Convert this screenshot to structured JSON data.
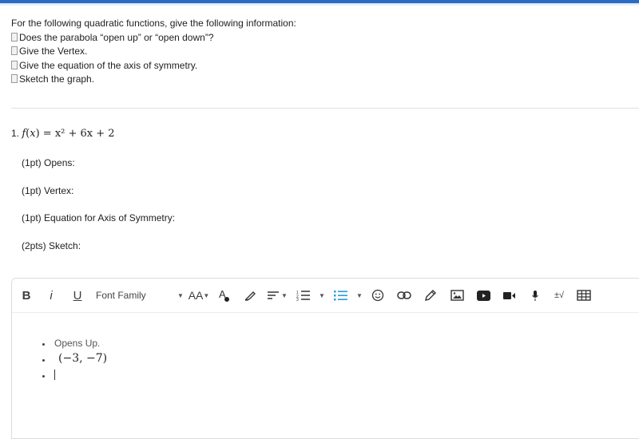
{
  "instructions": {
    "heading": "For the following quadratic functions, give the following information:",
    "items": [
      "Does the parabola “open up” or “open down”?",
      "Give the Vertex.",
      "Give the equation of the axis of symmetry.",
      "Sketch the graph."
    ]
  },
  "question": {
    "number": "1.",
    "function_name": "f",
    "variable": "x",
    "equation_rhs": "x² + 6x + 2",
    "parts": [
      {
        "label": "(1pt) Opens:"
      },
      {
        "label": "(1pt) Vertex:"
      },
      {
        "label": "(1pt)  Equation for Axis of Symmetry:"
      },
      {
        "label": "(2pts)  Sketch:"
      }
    ]
  },
  "toolbar": {
    "bold": "B",
    "italic": "i",
    "underline": "U",
    "font_family": "Font Family",
    "font_size_icon": "AA",
    "math_label": "±√",
    "accent_color": "#2a9fd6"
  },
  "answer": {
    "items": [
      "Opens Up.",
      "(−3, −7)",
      ""
    ]
  },
  "colors": {
    "top_bar": "#2a6bc6"
  }
}
